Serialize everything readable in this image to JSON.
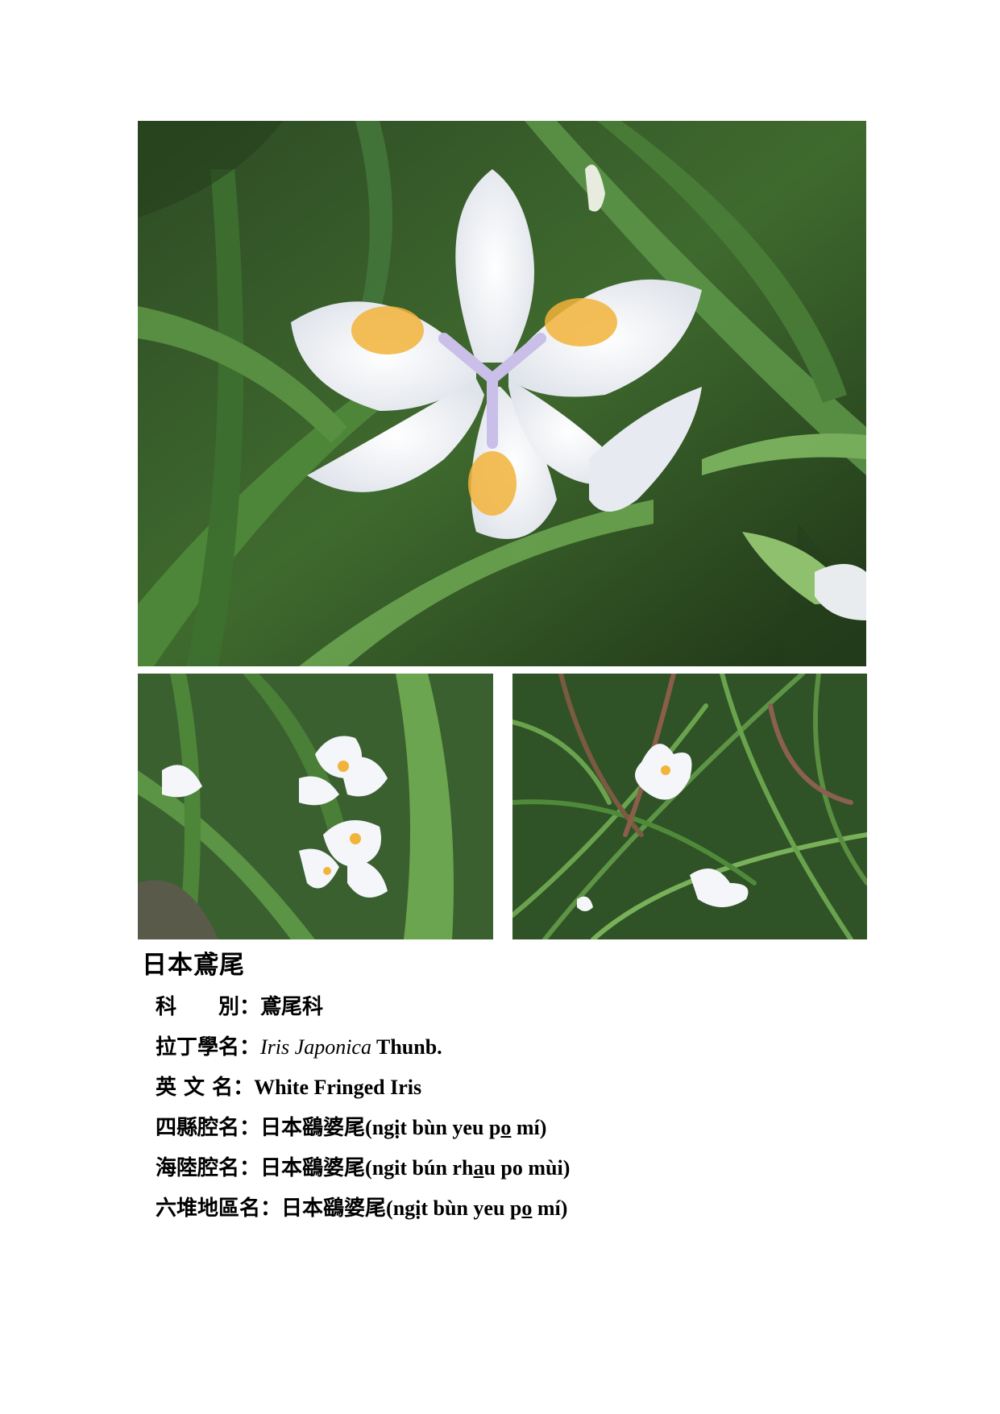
{
  "document": {
    "title": "日本鳶尾",
    "fields": [
      {
        "label": "科　　別",
        "value_cn": "鳶尾科"
      },
      {
        "label": "拉丁學名",
        "value_latin": "Iris Japonica",
        "value_author": " Thunb."
      },
      {
        "label": "英 文 名",
        "value_en": "White Fringed Iris"
      },
      {
        "label": "四縣腔名",
        "value_cn": "日本鷂婆尾",
        "pron_1": "(ngịt bùn yeu p",
        "pron_u": "o",
        "pron_2": " mí)"
      },
      {
        "label": "海陸腔名",
        "value_cn": "日本鷂婆尾",
        "pron_1": "(ngit bún rh",
        "pron_u": "a",
        "pron_2": "u po mùi)"
      },
      {
        "label": "六堆地區名",
        "value_cn": "日本鷂婆尾",
        "pron_1": "(ngịt bùn yeu p",
        "pron_u": "o",
        "pron_2": " mí)"
      }
    ],
    "colon": "："
  },
  "images": {
    "main": "white-iris-closeup-photo",
    "left": "iris-cluster-photo",
    "right": "iris-in-foliage-photo"
  }
}
